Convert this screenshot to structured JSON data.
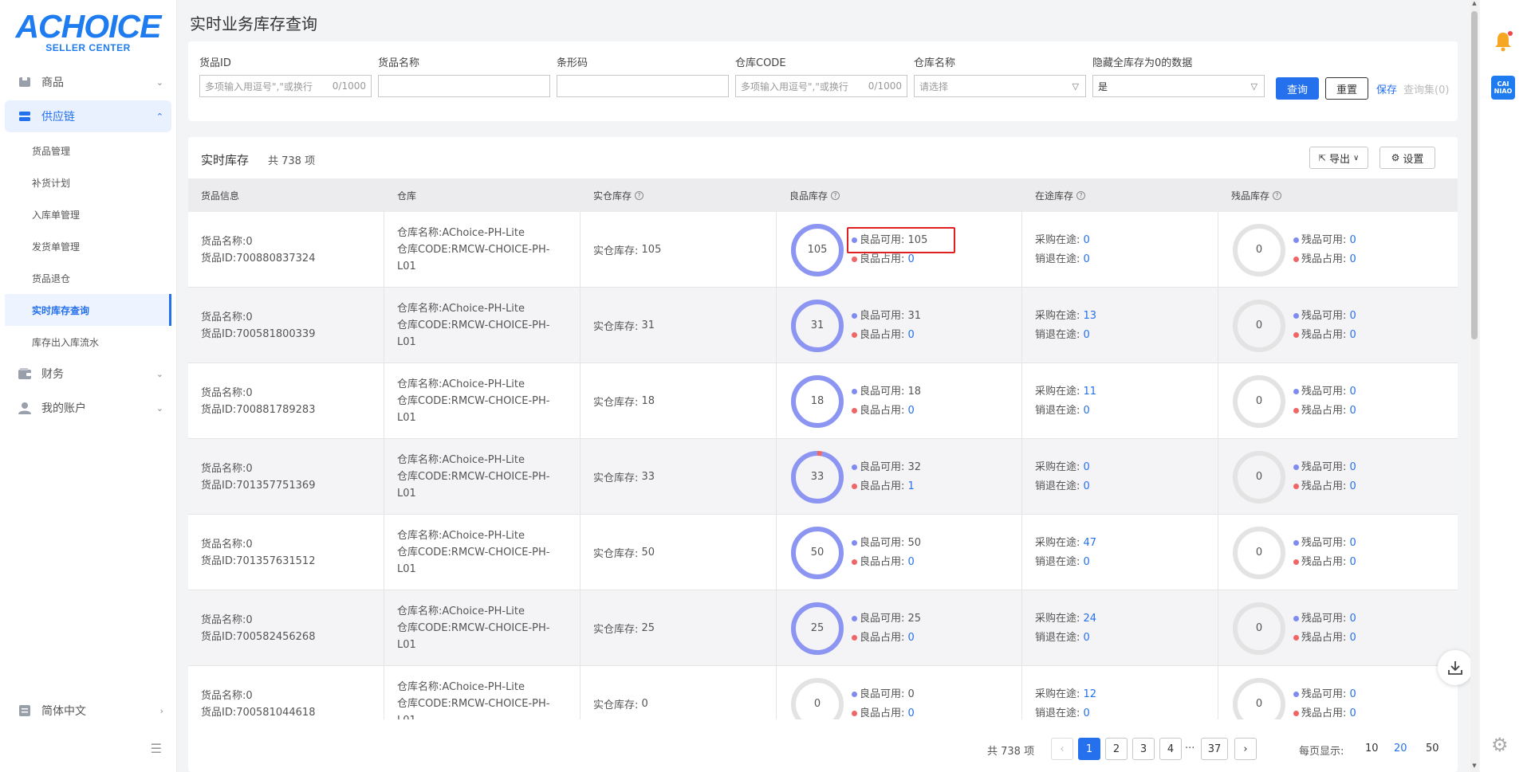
{
  "logo": {
    "main": "ACHOICE",
    "sub": "SELLER CENTER"
  },
  "sidebar": {
    "items": [
      {
        "label": "商品",
        "icon": "product-icon",
        "expanded": false
      },
      {
        "label": "供应链",
        "icon": "supply-chain-icon",
        "expanded": true
      },
      {
        "label": "财务",
        "icon": "wallet-icon",
        "expanded": false
      },
      {
        "label": "我的账户",
        "icon": "user-icon",
        "expanded": false
      }
    ],
    "sub_items": [
      "货品管理",
      "补货计划",
      "入库单管理",
      "发货单管理",
      "货品退仓",
      "实时库存查询",
      "库存出入库流水"
    ],
    "active_sub": "实时库存查询",
    "language": "简体中文"
  },
  "page": {
    "title": "实时业务库存查询"
  },
  "filters": {
    "goods_id": {
      "label": "货品ID",
      "placeholder": "多项输入用逗号\",\"或换行",
      "count": "0/1000"
    },
    "goods_name": {
      "label": "货品名称",
      "value": ""
    },
    "barcode": {
      "label": "条形码",
      "value": ""
    },
    "warehouse_code": {
      "label": "仓库CODE",
      "placeholder": "多项输入用逗号\",\"或换行",
      "count": "0/1000"
    },
    "warehouse_name": {
      "label": "仓库名称",
      "placeholder": "请选择"
    },
    "hide_zero": {
      "label": "隐藏全库存为0的数据",
      "value": "是"
    },
    "query_label": "查询",
    "reset_label": "重置",
    "save_label": "保存",
    "query_set_label": "查询集(0)"
  },
  "table": {
    "title": "实时库存",
    "count": "共 738 项",
    "export_label": "导出",
    "settings_label": "设置",
    "columns": [
      "货品信息",
      "仓库",
      "实仓库存",
      "良品库存",
      "在途库存",
      "残品库存"
    ],
    "rows": [
      {
        "name": "货品名称:0",
        "id": "货品ID:700880837324",
        "wh_name": "仓库名称:AChoice-PH-Lite",
        "wh_code": "仓库CODE:RMCW-CHOICE-PH-",
        "wh_code2": "L01",
        "real_label": "实仓库存:",
        "real": "105",
        "good_total": "105",
        "good_avail_label": "良品可用:",
        "good_avail": "105",
        "good_occ_label": "良品占用:",
        "good_occ": "0",
        "purch_label": "采购在途:",
        "purch": "0",
        "ret_label": "销退在途:",
        "ret": "0",
        "bad_total": "0",
        "bad_avail_label": "残品可用:",
        "bad_avail": "0",
        "bad_occ_label": "残品占用:",
        "bad_occ": "0"
      },
      {
        "name": "货品名称:0",
        "id": "货品ID:700581800339",
        "wh_name": "仓库名称:AChoice-PH-Lite",
        "wh_code": "仓库CODE:RMCW-CHOICE-PH-",
        "wh_code2": "L01",
        "real_label": "实仓库存:",
        "real": "31",
        "good_total": "31",
        "good_avail_label": "良品可用:",
        "good_avail": "31",
        "good_occ_label": "良品占用:",
        "good_occ": "0",
        "purch_label": "采购在途:",
        "purch": "13",
        "ret_label": "销退在途:",
        "ret": "0",
        "bad_total": "0",
        "bad_avail_label": "残品可用:",
        "bad_avail": "0",
        "bad_occ_label": "残品占用:",
        "bad_occ": "0"
      },
      {
        "name": "货品名称:0",
        "id": "货品ID:700881789283",
        "wh_name": "仓库名称:AChoice-PH-Lite",
        "wh_code": "仓库CODE:RMCW-CHOICE-PH-",
        "wh_code2": "L01",
        "real_label": "实仓库存:",
        "real": "18",
        "good_total": "18",
        "good_avail_label": "良品可用:",
        "good_avail": "18",
        "good_occ_label": "良品占用:",
        "good_occ": "0",
        "purch_label": "采购在途:",
        "purch": "11",
        "ret_label": "销退在途:",
        "ret": "0",
        "bad_total": "0",
        "bad_avail_label": "残品可用:",
        "bad_avail": "0",
        "bad_occ_label": "残品占用:",
        "bad_occ": "0"
      },
      {
        "name": "货品名称:0",
        "id": "货品ID:701357751369",
        "wh_name": "仓库名称:AChoice-PH-Lite",
        "wh_code": "仓库CODE:RMCW-CHOICE-PH-",
        "wh_code2": "L01",
        "real_label": "实仓库存:",
        "real": "33",
        "good_total": "33",
        "good_avail_label": "良品可用:",
        "good_avail": "32",
        "good_occ_label": "良品占用:",
        "good_occ": "1",
        "purch_label": "采购在途:",
        "purch": "0",
        "ret_label": "销退在途:",
        "ret": "0",
        "bad_total": "0",
        "bad_avail_label": "残品可用:",
        "bad_avail": "0",
        "bad_occ_label": "残品占用:",
        "bad_occ": "0"
      },
      {
        "name": "货品名称:0",
        "id": "货品ID:701357631512",
        "wh_name": "仓库名称:AChoice-PH-Lite",
        "wh_code": "仓库CODE:RMCW-CHOICE-PH-",
        "wh_code2": "L01",
        "real_label": "实仓库存:",
        "real": "50",
        "good_total": "50",
        "good_avail_label": "良品可用:",
        "good_avail": "50",
        "good_occ_label": "良品占用:",
        "good_occ": "0",
        "purch_label": "采购在途:",
        "purch": "47",
        "ret_label": "销退在途:",
        "ret": "0",
        "bad_total": "0",
        "bad_avail_label": "残品可用:",
        "bad_avail": "0",
        "bad_occ_label": "残品占用:",
        "bad_occ": "0"
      },
      {
        "name": "货品名称:0",
        "id": "货品ID:700582456268",
        "wh_name": "仓库名称:AChoice-PH-Lite",
        "wh_code": "仓库CODE:RMCW-CHOICE-PH-",
        "wh_code2": "L01",
        "real_label": "实仓库存:",
        "real": "25",
        "good_total": "25",
        "good_avail_label": "良品可用:",
        "good_avail": "25",
        "good_occ_label": "良品占用:",
        "good_occ": "0",
        "purch_label": "采购在途:",
        "purch": "24",
        "ret_label": "销退在途:",
        "ret": "0",
        "bad_total": "0",
        "bad_avail_label": "残品可用:",
        "bad_avail": "0",
        "bad_occ_label": "残品占用:",
        "bad_occ": "0"
      },
      {
        "name": "货品名称:0",
        "id": "货品ID:700581044618",
        "wh_name": "仓库名称:AChoice-PH-Lite",
        "wh_code": "仓库CODE:RMCW-CHOICE-PH-",
        "wh_code2": "L01",
        "real_label": "实仓库存:",
        "real": "0",
        "good_total": "0",
        "good_avail_label": "良品可用:",
        "good_avail": "0",
        "good_occ_label": "良品占用:",
        "good_occ": "0",
        "purch_label": "采购在途:",
        "purch": "12",
        "ret_label": "销退在途:",
        "ret": "0",
        "bad_total": "0",
        "bad_avail_label": "残品可用:",
        "bad_avail": "0",
        "bad_occ_label": "残品占用:",
        "bad_occ": "0"
      }
    ]
  },
  "pagination": {
    "total": "共 738 项",
    "pages": [
      "1",
      "2",
      "3",
      "4"
    ],
    "ellipsis": "···",
    "last": "37",
    "current": "1",
    "per_page_label": "每页显示:",
    "sizes": [
      "10",
      "20",
      "50"
    ],
    "selected_size": "20"
  },
  "colors": {
    "accent": "#2570ec",
    "ring_good": "#8c96f2",
    "ring_bad": "#f06565",
    "ring_empty": "#e3e3e3",
    "highlight": "#e02020"
  }
}
